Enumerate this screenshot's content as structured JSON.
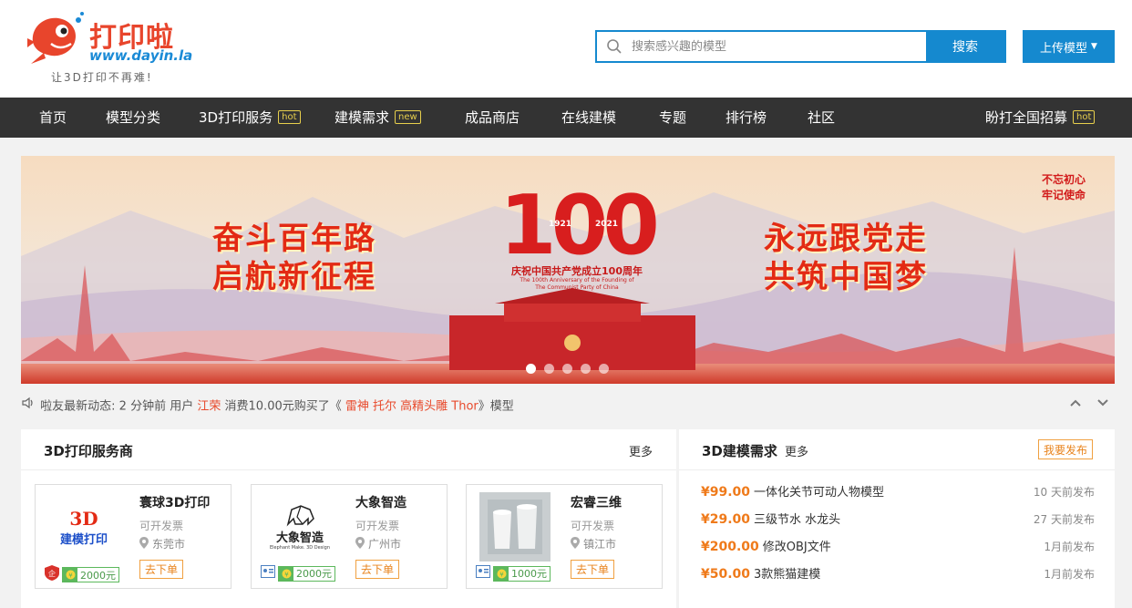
{
  "header": {
    "logo_name": "打印啦",
    "logo_url": "www.dayin.la",
    "slogan": "让3D打印不再难!",
    "search_placeholder": "搜索感兴趣的模型",
    "search_button": "搜索",
    "upload_button": "上传模型"
  },
  "nav": {
    "items": [
      {
        "label": "首页"
      },
      {
        "label": "模型分类"
      },
      {
        "label": "3D打印服务",
        "badge": "hot"
      },
      {
        "label": "建模需求",
        "badge": "new"
      },
      {
        "label": "成品商店"
      },
      {
        "label": "在线建模"
      },
      {
        "label": "专题"
      },
      {
        "label": "排行榜"
      },
      {
        "label": "社区"
      }
    ],
    "right": {
      "label": "盼打全国招募",
      "badge": "hot"
    }
  },
  "banner": {
    "left_line1": "奋斗百年路",
    "left_line2": "启航新征程",
    "right_line1": "永远跟党走",
    "right_line2": "共筑中国梦",
    "seal_line1": "不忘初心",
    "seal_line2": "牢记使命",
    "big_number": "100",
    "year_start": "1921",
    "year_end": "2021",
    "title": "庆祝中国共产党成立100周年",
    "subtitle_line1": "The 100th Anniversary of the Founding of",
    "subtitle_line2": "The Communist Party of China",
    "slide_count": 5,
    "active_slide": 1
  },
  "ticker": {
    "prefix": "啦友最新动态:",
    "time": "2 分钟前 用户",
    "user": "江荣",
    "action": "消费10.00元购买了《",
    "item": "雷神 托尔 高精头雕 Thor",
    "suffix": "》模型"
  },
  "services": {
    "title": "3D打印服务商",
    "more": "更多",
    "cards": [
      {
        "name": "寰球3D打印",
        "logo_line1": "3D",
        "logo_line2": "建模打印",
        "invoice": "可开发票",
        "city": "东莞市",
        "deposit": "2000元",
        "order": "去下单"
      },
      {
        "name": "大象智造",
        "logo_line1": "大象智造",
        "logo_line2": "Elephant Make. 3D Design",
        "invoice": "可开发票",
        "city": "广州市",
        "deposit": "2000元",
        "order": "去下单"
      },
      {
        "name": "宏睿三维",
        "invoice": "可开发票",
        "city": "镇江市",
        "deposit": "1000元",
        "order": "去下单"
      }
    ]
  },
  "requests": {
    "title": "3D建模需求",
    "more": "更多",
    "publish": "我要发布",
    "items": [
      {
        "price": "¥99.00",
        "text": "一体化关节可动人物模型",
        "time": "10 天前发布"
      },
      {
        "price": "¥29.00",
        "text": "三级节水 水龙头",
        "time": "27 天前发布"
      },
      {
        "price": "¥200.00",
        "text": "修改OBJ文件",
        "time": "1月前发布"
      },
      {
        "price": "¥50.00",
        "text": "3款熊猫建模",
        "time": "1月前发布"
      }
    ]
  },
  "colors": {
    "brand_blue": "#1589cf",
    "brand_red": "#e8452c",
    "nav_bg": "#333333",
    "badge": "#e7cf4c",
    "price": "#ef7a1a"
  }
}
